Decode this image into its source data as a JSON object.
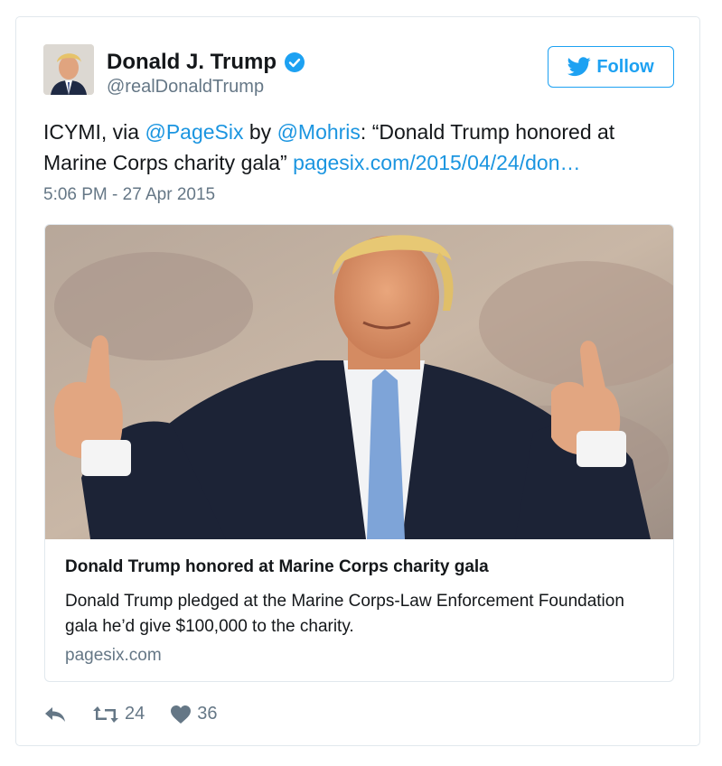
{
  "tweet": {
    "display_name": "Donald J. Trump",
    "handle": "@realDonaldTrump",
    "follow_label": "Follow",
    "text": {
      "prefix": "ICYMI, via ",
      "mention1": "@PageSix",
      "by": " by ",
      "mention2": "@Mohris",
      "quote": ": “Donald Trump honored at Marine Corps charity gala” ",
      "url": "pagesix.com/2015/04/24/don…"
    },
    "timestamp": "5:06 PM - 27 Apr 2015"
  },
  "card": {
    "title": "Donald Trump honored at Marine Corps charity gala",
    "description": "Donald Trump pledged at the Marine Corps-Law Enforcement Foundation gala he’d give $100,000 to the charity.",
    "domain": "pagesix.com"
  },
  "actions": {
    "reply_icon": "reply-icon",
    "retweet_icon": "retweet-icon",
    "retweet_count": "24",
    "like_icon": "heart-icon",
    "like_count": "36"
  },
  "colors": {
    "accent": "#1da1f2",
    "link": "#1b95e0",
    "muted": "#657786",
    "border": "#e1e8ed"
  }
}
